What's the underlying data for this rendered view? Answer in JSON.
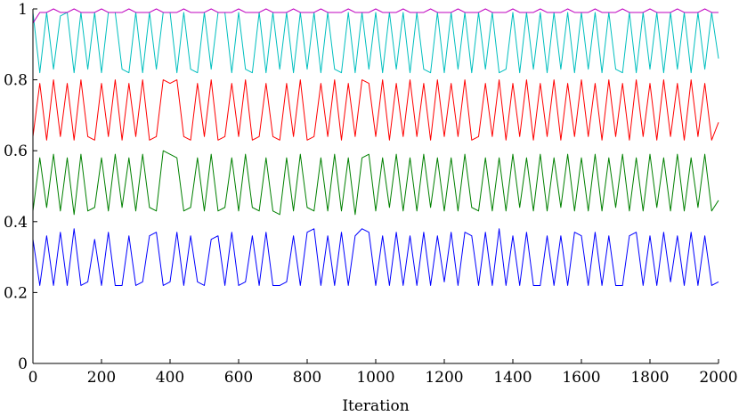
{
  "chart_data": {
    "type": "line",
    "title": "",
    "xlabel": "Iteration",
    "ylabel": "",
    "xlim": [
      0,
      2000
    ],
    "ylim": [
      0,
      1
    ],
    "xticks": [
      0,
      200,
      400,
      600,
      800,
      1000,
      1200,
      1400,
      1600,
      1800,
      2000
    ],
    "yticks": [
      0,
      0.2,
      0.4,
      0.6,
      0.8,
      1
    ],
    "ytick_labels": [
      "0",
      "0.2",
      "0.4",
      "0.6",
      "0.8",
      "1"
    ],
    "grid": false,
    "legend": "none",
    "series": [
      {
        "color": "#0000ff",
        "values": [
          0.35,
          0.22,
          0.36,
          0.22,
          0.37,
          0.22,
          0.38,
          0.22,
          0.23,
          0.35,
          0.22,
          0.37,
          0.22,
          0.22,
          0.36,
          0.22,
          0.23,
          0.36,
          0.37,
          0.22,
          0.23,
          0.37,
          0.22,
          0.36,
          0.23,
          0.22,
          0.35,
          0.36,
          0.22,
          0.37,
          0.22,
          0.23,
          0.36,
          0.22,
          0.37,
          0.22,
          0.22,
          0.23,
          0.36,
          0.22,
          0.37,
          0.38,
          0.22,
          0.36,
          0.22,
          0.37,
          0.22,
          0.36,
          0.38,
          0.37,
          0.22,
          0.36,
          0.22,
          0.37,
          0.22,
          0.36,
          0.22,
          0.37,
          0.22,
          0.36,
          0.23,
          0.37,
          0.22,
          0.37,
          0.36,
          0.22,
          0.37,
          0.22,
          0.38,
          0.22,
          0.36,
          0.22,
          0.37,
          0.22,
          0.22,
          0.36,
          0.22,
          0.36,
          0.22,
          0.37,
          0.36,
          0.22,
          0.37,
          0.22,
          0.36,
          0.22,
          0.22,
          0.36,
          0.37,
          0.22,
          0.36,
          0.22,
          0.37,
          0.23,
          0.36,
          0.22,
          0.37,
          0.22,
          0.36,
          0.22,
          0.23
        ]
      },
      {
        "color": "#008000",
        "values": [
          0.43,
          0.58,
          0.44,
          0.59,
          0.43,
          0.58,
          0.42,
          0.59,
          0.43,
          0.44,
          0.58,
          0.43,
          0.59,
          0.44,
          0.58,
          0.43,
          0.59,
          0.44,
          0.43,
          0.6,
          0.59,
          0.58,
          0.43,
          0.44,
          0.58,
          0.43,
          0.59,
          0.43,
          0.44,
          0.58,
          0.43,
          0.59,
          0.44,
          0.43,
          0.58,
          0.43,
          0.42,
          0.58,
          0.43,
          0.59,
          0.44,
          0.43,
          0.58,
          0.43,
          0.59,
          0.43,
          0.58,
          0.42,
          0.58,
          0.59,
          0.43,
          0.58,
          0.44,
          0.59,
          0.43,
          0.58,
          0.43,
          0.59,
          0.44,
          0.58,
          0.43,
          0.58,
          0.43,
          0.59,
          0.44,
          0.43,
          0.58,
          0.43,
          0.58,
          0.43,
          0.59,
          0.44,
          0.58,
          0.43,
          0.59,
          0.43,
          0.58,
          0.44,
          0.59,
          0.43,
          0.58,
          0.43,
          0.59,
          0.43,
          0.58,
          0.44,
          0.59,
          0.43,
          0.58,
          0.43,
          0.59,
          0.44,
          0.58,
          0.43,
          0.59,
          0.43,
          0.58,
          0.44,
          0.59,
          0.43,
          0.46
        ]
      },
      {
        "color": "#ff0000",
        "values": [
          0.64,
          0.79,
          0.63,
          0.8,
          0.64,
          0.79,
          0.63,
          0.8,
          0.64,
          0.63,
          0.79,
          0.64,
          0.8,
          0.63,
          0.79,
          0.64,
          0.8,
          0.63,
          0.64,
          0.8,
          0.79,
          0.8,
          0.64,
          0.63,
          0.79,
          0.64,
          0.8,
          0.63,
          0.64,
          0.79,
          0.64,
          0.8,
          0.63,
          0.64,
          0.79,
          0.64,
          0.63,
          0.79,
          0.64,
          0.8,
          0.63,
          0.64,
          0.79,
          0.64,
          0.8,
          0.63,
          0.79,
          0.64,
          0.8,
          0.79,
          0.64,
          0.8,
          0.63,
          0.79,
          0.64,
          0.8,
          0.64,
          0.79,
          0.63,
          0.8,
          0.64,
          0.79,
          0.64,
          0.8,
          0.63,
          0.64,
          0.79,
          0.64,
          0.8,
          0.63,
          0.79,
          0.64,
          0.8,
          0.63,
          0.79,
          0.64,
          0.8,
          0.63,
          0.79,
          0.64,
          0.8,
          0.64,
          0.79,
          0.63,
          0.8,
          0.64,
          0.79,
          0.63,
          0.8,
          0.64,
          0.79,
          0.63,
          0.8,
          0.64,
          0.79,
          0.63,
          0.8,
          0.64,
          0.79,
          0.63,
          0.68
        ]
      },
      {
        "color": "#00bfbf",
        "values": [
          0.99,
          0.82,
          0.99,
          0.83,
          0.98,
          0.99,
          0.82,
          0.99,
          0.83,
          0.99,
          0.82,
          0.99,
          0.99,
          0.83,
          0.82,
          0.99,
          0.82,
          0.99,
          0.83,
          0.99,
          0.99,
          0.82,
          0.99,
          0.83,
          0.82,
          0.99,
          0.83,
          0.99,
          0.99,
          0.82,
          0.99,
          0.83,
          0.82,
          0.99,
          0.82,
          0.99,
          0.83,
          0.99,
          0.82,
          0.99,
          0.83,
          0.99,
          0.82,
          0.99,
          0.83,
          0.82,
          0.99,
          0.82,
          0.99,
          0.83,
          0.99,
          0.82,
          0.99,
          0.83,
          0.99,
          0.82,
          0.99,
          0.83,
          0.82,
          0.99,
          0.82,
          0.99,
          0.83,
          0.99,
          0.82,
          0.99,
          0.83,
          0.99,
          0.82,
          0.83,
          0.99,
          0.82,
          0.99,
          0.83,
          0.99,
          0.82,
          0.99,
          0.83,
          0.99,
          0.82,
          0.99,
          0.83,
          0.99,
          0.82,
          0.99,
          0.83,
          0.82,
          0.99,
          0.82,
          0.99,
          0.83,
          0.99,
          0.82,
          0.99,
          0.83,
          0.99,
          0.82,
          0.99,
          0.83,
          0.99,
          0.86
        ]
      },
      {
        "color": "#bf00bf",
        "values": [
          0.96,
          0.99,
          0.99,
          1.0,
          0.99,
          0.99,
          1.0,
          0.99,
          0.99,
          0.99,
          1.0,
          0.99,
          0.99,
          0.99,
          1.0,
          0.99,
          0.99,
          0.99,
          1.0,
          0.99,
          0.99,
          0.99,
          1.0,
          0.99,
          0.99,
          0.99,
          1.0,
          0.99,
          0.99,
          0.99,
          1.0,
          0.99,
          0.99,
          0.99,
          1.0,
          0.99,
          0.99,
          0.99,
          1.0,
          0.99,
          0.99,
          0.99,
          1.0,
          0.99,
          0.99,
          0.99,
          1.0,
          0.99,
          0.99,
          0.99,
          1.0,
          0.99,
          0.99,
          0.99,
          1.0,
          0.99,
          0.99,
          0.99,
          1.0,
          0.99,
          0.99,
          0.99,
          1.0,
          0.99,
          0.99,
          0.99,
          1.0,
          0.99,
          0.99,
          0.99,
          1.0,
          0.99,
          0.99,
          0.99,
          1.0,
          0.99,
          0.99,
          0.99,
          1.0,
          0.99,
          0.99,
          0.99,
          1.0,
          0.99,
          0.99,
          0.99,
          1.0,
          0.99,
          0.99,
          0.99,
          1.0,
          0.99,
          0.99,
          0.99,
          1.0,
          0.99,
          0.99,
          0.99,
          1.0,
          0.99,
          0.99
        ]
      }
    ]
  }
}
